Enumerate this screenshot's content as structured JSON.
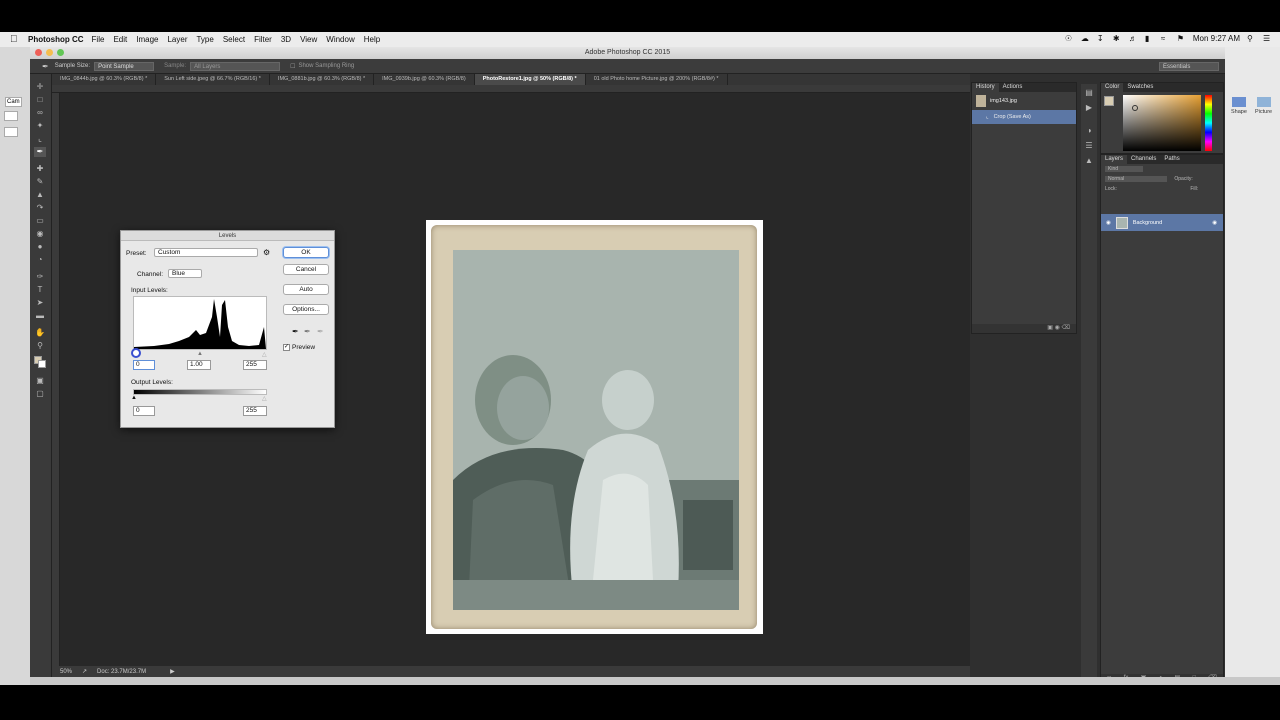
{
  "mac_menu": {
    "app_name": "Photoshop CC",
    "items": [
      "File",
      "Edit",
      "Image",
      "Layer",
      "Type",
      "Select",
      "Filter",
      "3D",
      "View",
      "Window",
      "Help"
    ],
    "clock": "Mon 9:27 AM"
  },
  "window": {
    "title": "Adobe Photoshop CC 2015"
  },
  "options_bar": {
    "sample_size_label": "Sample Size:",
    "sample_size_value": "Point Sample",
    "sample_label": "Sample:",
    "sample_value": "All Layers",
    "show_ring_label": "Show Sampling Ring",
    "workspace": "Essentials"
  },
  "doc_tabs": [
    {
      "label": "IMG_0844b.jpg @ 60.3% (RGB/8) *"
    },
    {
      "label": "Sun Left side.jpeg @ 66.7% (RGB/16) *"
    },
    {
      "label": "IMG_0881b.jpg @ 60.3% (RGB/8) *"
    },
    {
      "label": "IMG_0939b.jpg @ 60.3% (RGB/8)"
    },
    {
      "label": "PhotoRestore1.jpg @ 50% (RGB/8) *"
    },
    {
      "label": "01 old Photo home Picture.jpg @ 200% (RGB/8#) *"
    }
  ],
  "status": {
    "zoom": "50%",
    "doc": "Doc: 23.7M/23.7M"
  },
  "history_panel": {
    "tabs": [
      "History",
      "Actions"
    ],
    "snapshot": "img143.jpg",
    "state": "Crop (Save As)"
  },
  "color_panel": {
    "tabs": [
      "Color",
      "Swatches"
    ]
  },
  "layers_panel": {
    "tabs": [
      "Layers",
      "Channels",
      "Paths"
    ],
    "kind": "Kind",
    "blend_mode": "Normal",
    "opacity_label": "Opacity:",
    "lock_label": "Lock:",
    "fill_label": "Fill:",
    "layer_name": "Background"
  },
  "bg_window": {
    "shape_label": "Shape",
    "picture_label": "Picture",
    "left_snippet": "Cam"
  },
  "levels": {
    "title": "Levels",
    "preset_label": "Preset:",
    "preset_value": "Custom",
    "channel_label": "Channel:",
    "channel_value": "Blue",
    "input_label": "Input Levels:",
    "input_black": "0",
    "input_gamma": "1.00",
    "input_white": "255",
    "output_label": "Output Levels:",
    "output_black": "0",
    "output_white": "255",
    "ok_label": "OK",
    "cancel_label": "Cancel",
    "auto_label": "Auto",
    "options_label": "Options...",
    "preview_label": "Preview",
    "preview_checked": true
  }
}
